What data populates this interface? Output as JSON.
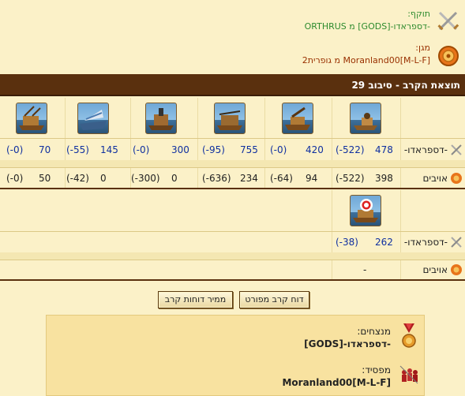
{
  "attacker": {
    "label": "תוקף:",
    "value": "-דספראדו-[GODS] מ ORTHRUS"
  },
  "defender": {
    "label": "מגן:",
    "value": "Moranland00[M-L-F] מ גופרית2"
  },
  "round_title": "תוצאת הקרב - סיבוב 29",
  "rows": {
    "attacker_label": "-דספראדו-",
    "enemies_label": "אויבים"
  },
  "group1": {
    "units": [
      "ram-ship",
      "catapult-ship",
      "ballista-ship",
      "mortar-ship",
      "steam-ram",
      "paddle-ship"
    ],
    "attacker": [
      {
        "count": "478",
        "loss": "(-522)"
      },
      {
        "count": "420",
        "loss": "(-0)"
      },
      {
        "count": "755",
        "loss": "(-95)"
      },
      {
        "count": "300",
        "loss": "(-0)"
      },
      {
        "count": "145",
        "loss": "(-55)"
      },
      {
        "count": "70",
        "loss": "(-0)"
      }
    ],
    "enemies": [
      {
        "count": "398",
        "loss": "(-522)"
      },
      {
        "count": "94",
        "loss": "(-64)"
      },
      {
        "count": "234",
        "loss": "(-636)"
      },
      {
        "count": "0",
        "loss": "(-300)"
      },
      {
        "count": "0",
        "loss": "(-42)"
      },
      {
        "count": "50",
        "loss": "(-0)"
      }
    ]
  },
  "group2": {
    "units": [
      "target-ship"
    ],
    "attacker": [
      {
        "count": "262",
        "loss": "(-38)"
      }
    ],
    "enemies": [
      {
        "count": "-"
      }
    ]
  },
  "buttons": {
    "detailed": "דוח קרב מפורט",
    "converter": "ממיר דוחות קרב"
  },
  "results": {
    "winners_label": "מנצחים:",
    "winners_value": "-דספראדו-[GODS]",
    "losers_label": "מפסיד:",
    "losers_value": "Moranland00[M-L-F]"
  },
  "colors": {
    "background": "#fbf1c8",
    "title_bar": "#5a300e",
    "attacker_text": "#2e8b2e",
    "defender_text": "#993000",
    "numbers": "#1030a0",
    "result_box": "#f8e2a0"
  }
}
